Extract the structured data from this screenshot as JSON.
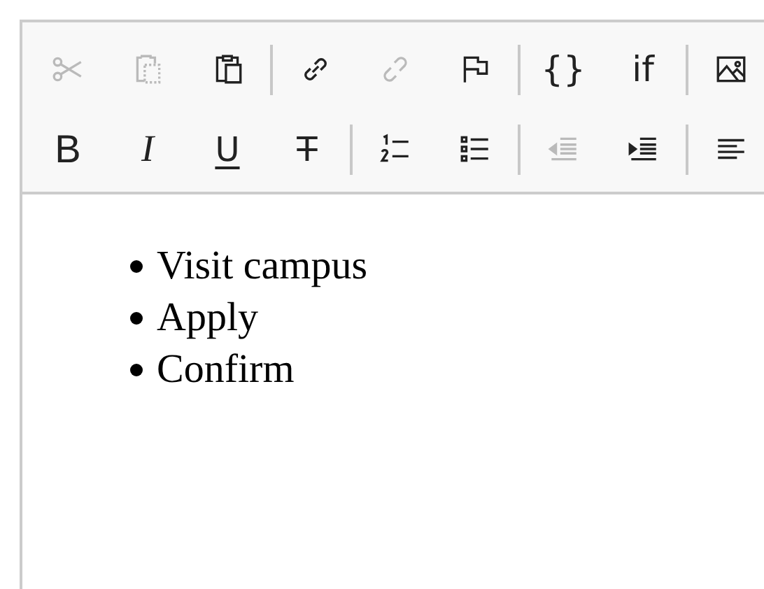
{
  "toolbar": {
    "rows": [
      [
        {
          "kind": "cut",
          "disabled": true
        },
        {
          "kind": "copy",
          "disabled": true
        },
        {
          "kind": "paste",
          "disabled": false
        },
        {
          "kind": "separator"
        },
        {
          "kind": "link",
          "disabled": false
        },
        {
          "kind": "unlink",
          "disabled": true
        },
        {
          "kind": "anchor",
          "disabled": false
        },
        {
          "kind": "separator"
        },
        {
          "kind": "code",
          "label": "{}",
          "disabled": false
        },
        {
          "kind": "code",
          "label": "if",
          "disabled": false
        },
        {
          "kind": "separator"
        },
        {
          "kind": "image",
          "disabled": false
        }
      ],
      [
        {
          "kind": "bold",
          "label": "B",
          "disabled": false
        },
        {
          "kind": "italic",
          "label": "I",
          "disabled": false
        },
        {
          "kind": "underline",
          "label": "U",
          "disabled": false
        },
        {
          "kind": "strike",
          "label": "T",
          "disabled": false
        },
        {
          "kind": "separator"
        },
        {
          "kind": "ordered-list",
          "disabled": false
        },
        {
          "kind": "bullet-list",
          "disabled": false
        },
        {
          "kind": "separator"
        },
        {
          "kind": "outdent",
          "disabled": true
        },
        {
          "kind": "indent",
          "disabled": false
        },
        {
          "kind": "separator"
        },
        {
          "kind": "align",
          "disabled": false
        }
      ]
    ]
  },
  "content": {
    "bullets": [
      "Visit campus",
      "Apply",
      "Confirm"
    ]
  }
}
